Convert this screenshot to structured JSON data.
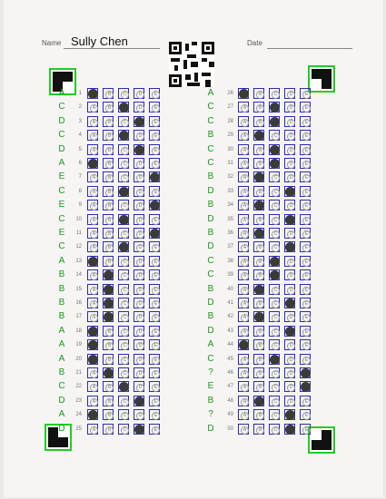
{
  "header": {
    "name_label": "Name",
    "name_value": "Sully Chen",
    "date_label": "Date"
  },
  "choices": [
    "A",
    "B",
    "C",
    "D",
    "E"
  ],
  "questions": [
    {
      "n": 1,
      "key": "A",
      "filled": "A"
    },
    {
      "n": 2,
      "key": "C",
      "filled": "C"
    },
    {
      "n": 3,
      "key": "D",
      "filled": "D"
    },
    {
      "n": 4,
      "key": "C",
      "filled": "C"
    },
    {
      "n": 5,
      "key": "D",
      "filled": "D"
    },
    {
      "n": 6,
      "key": "A",
      "filled": "A"
    },
    {
      "n": 7,
      "key": "E",
      "filled": "E"
    },
    {
      "n": 8,
      "key": "C",
      "filled": "C"
    },
    {
      "n": 9,
      "key": "E",
      "filled": "E"
    },
    {
      "n": 10,
      "key": "C",
      "filled": "C"
    },
    {
      "n": 11,
      "key": "E",
      "filled": "E"
    },
    {
      "n": 12,
      "key": "C",
      "filled": "C"
    },
    {
      "n": 13,
      "key": "A",
      "filled": "A"
    },
    {
      "n": 14,
      "key": "B",
      "filled": "B"
    },
    {
      "n": 15,
      "key": "B",
      "filled": "B"
    },
    {
      "n": 16,
      "key": "B",
      "filled": "B"
    },
    {
      "n": 17,
      "key": "B",
      "filled": "B"
    },
    {
      "n": 18,
      "key": "A",
      "filled": "A"
    },
    {
      "n": 19,
      "key": "A",
      "filled": "A"
    },
    {
      "n": 20,
      "key": "A",
      "filled": "A"
    },
    {
      "n": 21,
      "key": "B",
      "filled": "B"
    },
    {
      "n": 22,
      "key": "C",
      "filled": "C"
    },
    {
      "n": 23,
      "key": "D",
      "filled": "D"
    },
    {
      "n": 24,
      "key": "A",
      "filled": "A"
    },
    {
      "n": 25,
      "key": "D",
      "filled": "D"
    },
    {
      "n": 26,
      "key": "A",
      "filled": "A"
    },
    {
      "n": 27,
      "key": "C",
      "filled": "C"
    },
    {
      "n": 28,
      "key": "C",
      "filled": "C"
    },
    {
      "n": 29,
      "key": "B",
      "filled": "B"
    },
    {
      "n": 30,
      "key": "C",
      "filled": "C"
    },
    {
      "n": 31,
      "key": "C",
      "filled": "C"
    },
    {
      "n": 32,
      "key": "B",
      "filled": "B"
    },
    {
      "n": 33,
      "key": "D",
      "filled": "D"
    },
    {
      "n": 34,
      "key": "B",
      "filled": "B"
    },
    {
      "n": 35,
      "key": "D",
      "filled": "D"
    },
    {
      "n": 36,
      "key": "B",
      "filled": "B"
    },
    {
      "n": 37,
      "key": "D",
      "filled": "D"
    },
    {
      "n": 38,
      "key": "C",
      "filled": "C"
    },
    {
      "n": 39,
      "key": "C",
      "filled": "C"
    },
    {
      "n": 40,
      "key": "B",
      "filled": "B"
    },
    {
      "n": 41,
      "key": "D",
      "filled": "D"
    },
    {
      "n": 42,
      "key": "B",
      "filled": "B"
    },
    {
      "n": 43,
      "key": "D",
      "filled": "D"
    },
    {
      "n": 44,
      "key": "A",
      "filled": "A"
    },
    {
      "n": 45,
      "key": "C",
      "filled": "C"
    },
    {
      "n": 46,
      "key": "?",
      "filled": "E"
    },
    {
      "n": 47,
      "key": "E",
      "filled": "E"
    },
    {
      "n": 48,
      "key": "B",
      "filled": "B"
    },
    {
      "n": 49,
      "key": "?",
      "filled": "D"
    },
    {
      "n": 50,
      "key": "D",
      "filled": "D"
    }
  ],
  "colors": {
    "key_green": "#1a9a1a",
    "box_blue": "#2a2ab8",
    "fiducial_green": "#22cc22"
  }
}
